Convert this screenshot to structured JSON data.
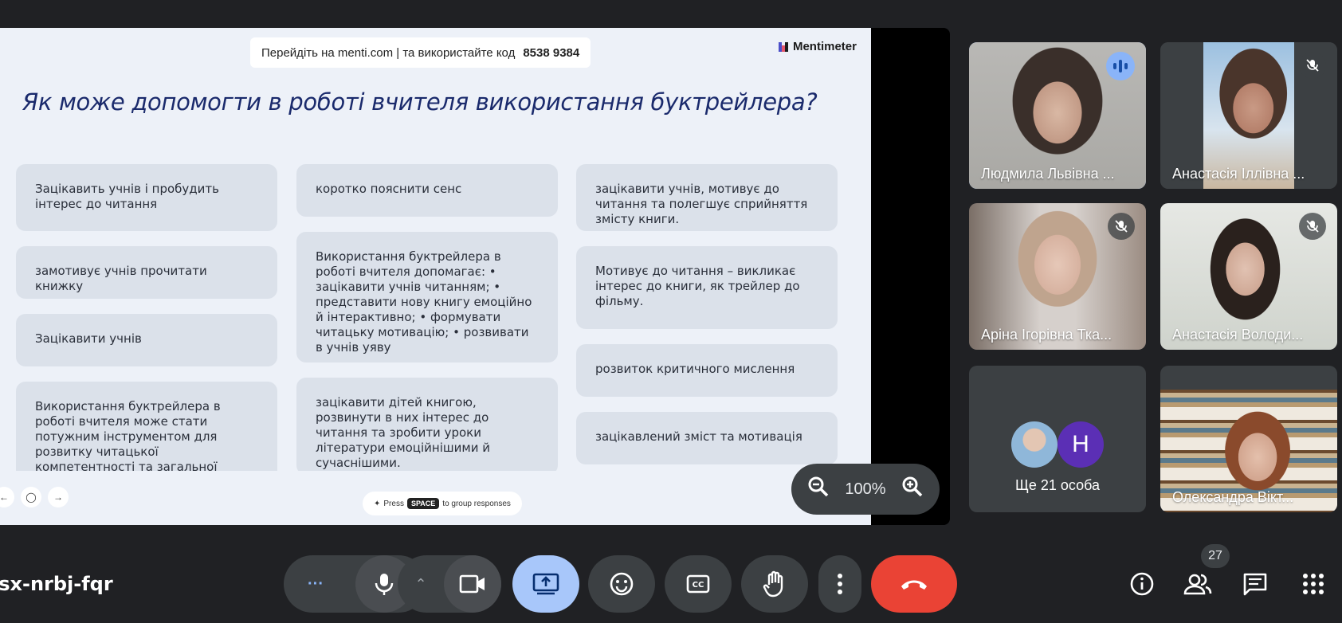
{
  "slide": {
    "join_text": "Перейдіть на menti.com | та використайте код",
    "join_code": "8538 9384",
    "brand": "Mentimeter",
    "question": "Як може допомогти в роботі вчителя використання буктрейлера?",
    "columns": [
      [
        "Зацікавить учнів і пробудить інтерес до читання",
        "замотивує учнів прочитати книжку",
        "Зацікавити учнів",
        "Використання буктрейлера в роботі вчителя може стати потужним інструментом для розвитку читацької компетентності та загальної мотивації учнів."
      ],
      [
        "коротко пояснити сенс",
        "Використання буктрейлера в роботі вчителя допомагає: • зацікавити учнів читанням; • представити нову книгу емоційно й інтерактивно; • формувати читацьку мотивацію; • розвивати в учнів уяву",
        "зацікавити дітей книгою, розвинути в них інтерес до читання та зробити уроки літератури емоційнішими й сучаснішими."
      ],
      [
        "зацікавити учнів, мотивує до читання та полегшує сприйняття змісту книги.",
        "Мотивує до читання – викликає інтерес до книги, як трейлер до фільму.",
        "розвиток критичного мислення",
        "зацікавлений зміст та мотивація"
      ]
    ],
    "hint_press": "Press",
    "hint_key": "SPACE",
    "hint_rest": "to group responses"
  },
  "zoom": {
    "level": "100%",
    "zoom_out_icon": "zoom-out-icon",
    "zoom_in_icon": "zoom-in-icon"
  },
  "participants": [
    {
      "name": "Людмила Львівна ...",
      "state": "speaking"
    },
    {
      "name": "Анастасія Іллівна ...",
      "state": "muted"
    },
    {
      "name": "Аріна Ігорівна Тка...",
      "state": "muted"
    },
    {
      "name": "Анастасія Володи...",
      "state": "muted"
    },
    {
      "name": "Олександра Вікт...",
      "state": "video"
    }
  ],
  "more": {
    "avatar_letter": "H",
    "label": "Ще 21 особа"
  },
  "bottom": {
    "meeting_code": "isx-nrbj-fqr",
    "people_count": "27"
  },
  "colors": {
    "end_call": "#ea4335",
    "present_active": "#a8c7fa",
    "speaking": "#8ab4f8",
    "avatar_h": "#5b2fb5"
  }
}
